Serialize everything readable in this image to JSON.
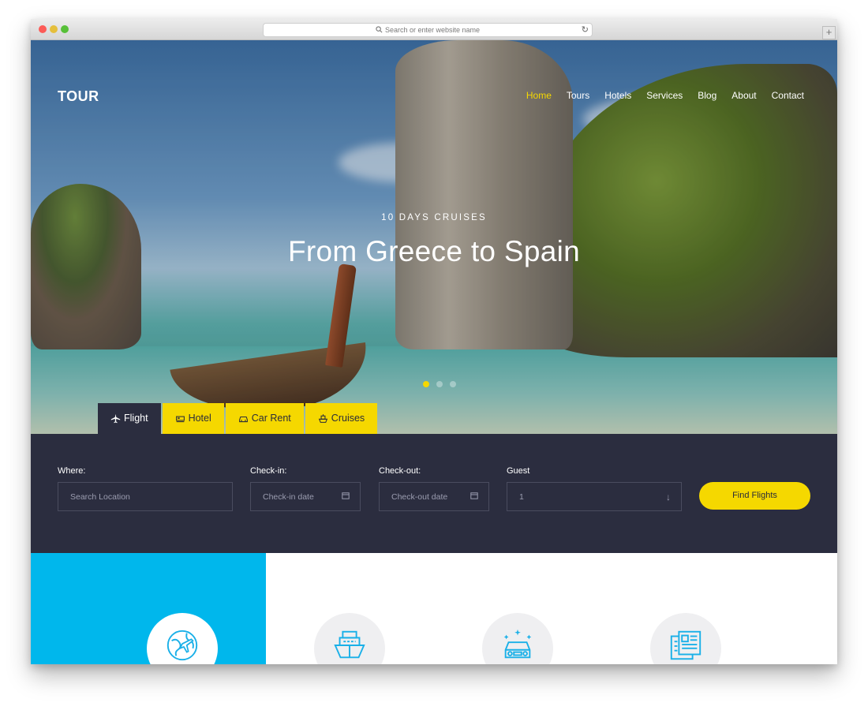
{
  "browser": {
    "url_placeholder": "Search or enter website name",
    "reload_icon": "↻",
    "new_tab_icon": "+"
  },
  "header": {
    "logo": "TOUR",
    "nav": [
      "Home",
      "Tours",
      "Hotels",
      "Services",
      "Blog",
      "About",
      "Contact"
    ],
    "active_nav": "Home"
  },
  "hero": {
    "subtitle": "10 DAYS CRUISES",
    "title": "From Greece to Spain",
    "slides": 3,
    "active_slide": 1
  },
  "tabs": [
    {
      "label": "Flight",
      "icon": "plane-icon",
      "active": true
    },
    {
      "label": "Hotel",
      "icon": "bed-icon",
      "active": false
    },
    {
      "label": "Car Rent",
      "icon": "car-icon",
      "active": false
    },
    {
      "label": "Cruises",
      "icon": "ship-icon",
      "active": false
    }
  ],
  "search": {
    "where_label": "Where:",
    "where_placeholder": "Search Location",
    "checkin_label": "Check-in:",
    "checkin_placeholder": "Check-in date",
    "checkout_label": "Check-out:",
    "checkout_placeholder": "Check-out date",
    "guest_label": "Guest",
    "guest_value": "1",
    "button": "Find Flights"
  },
  "features": {
    "icons": [
      "globe-plane-icon",
      "ship-icon",
      "car-sparkle-icon",
      "newspaper-icon"
    ]
  },
  "colors": {
    "accent": "#f5d800",
    "dark": "#2b2d3f",
    "blue": "#00b7ec",
    "icon": "#1ab0e8"
  }
}
